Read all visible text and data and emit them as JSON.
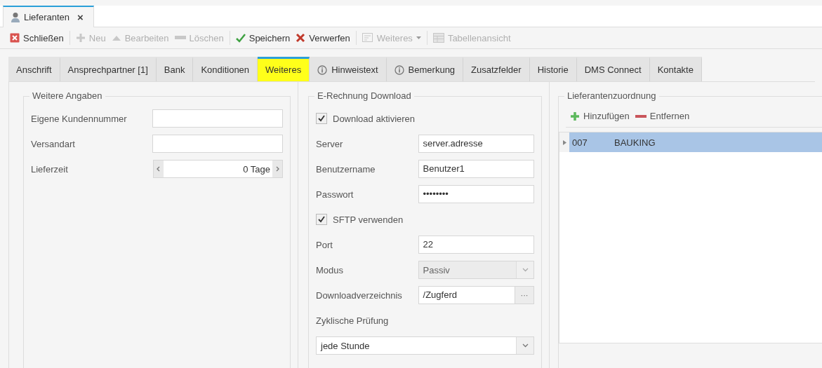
{
  "document_tab": {
    "title": "Lieferanten",
    "close": "×"
  },
  "toolbar": [
    {
      "kind": "close",
      "label": "Schließen",
      "disabled": false,
      "separator_after": true
    },
    {
      "kind": "new",
      "label": "Neu",
      "disabled": true,
      "separator_after": false
    },
    {
      "kind": "edit",
      "label": "Bearbeiten",
      "disabled": true,
      "separator_after": false
    },
    {
      "kind": "delete",
      "label": "Löschen",
      "disabled": true,
      "separator_after": true
    },
    {
      "kind": "save",
      "label": "Speichern",
      "disabled": false,
      "separator_after": false
    },
    {
      "kind": "discard",
      "label": "Verwerfen",
      "disabled": false,
      "separator_after": true
    },
    {
      "kind": "more",
      "label": "Weiteres",
      "disabled": true,
      "separator_after": true
    },
    {
      "kind": "table",
      "label": "Tabellenansicht",
      "disabled": true,
      "separator_after": false
    }
  ],
  "tabs": [
    {
      "label": "Anschrift",
      "kind": "plain",
      "selected": false
    },
    {
      "label": "Ansprechpartner [1]",
      "kind": "plain",
      "selected": false
    },
    {
      "label": "Bank",
      "kind": "plain",
      "selected": false
    },
    {
      "label": "Konditionen",
      "kind": "plain",
      "selected": false
    },
    {
      "label": "Weiteres",
      "kind": "plain",
      "selected": true
    },
    {
      "label": "Hinweistext",
      "kind": "info",
      "selected": false
    },
    {
      "label": "Bemerkung",
      "kind": "info",
      "selected": false
    },
    {
      "label": "Zusatzfelder",
      "kind": "plain",
      "selected": false
    },
    {
      "label": "Historie",
      "kind": "plain",
      "selected": false
    },
    {
      "label": "DMS Connect",
      "kind": "plain",
      "selected": false
    },
    {
      "label": "Kontakte",
      "kind": "plain",
      "selected": false
    }
  ],
  "weitere_angaben": {
    "title": "Weitere Angaben",
    "fields": [
      {
        "kind": "text",
        "label": "Eigene Kundennummer"
      },
      {
        "kind": "text",
        "label": "Versandart"
      },
      {
        "kind": "spinner",
        "label": "Lieferzeit",
        "value": "0 Tage"
      }
    ]
  },
  "e_rechnung": {
    "title": "E-Rechnung Download",
    "fields": [
      {
        "kind": "checkbox",
        "label": "Download aktivieren",
        "checked": true
      },
      {
        "kind": "text",
        "label": "Server",
        "value": "server.adresse"
      },
      {
        "kind": "text",
        "label": "Benutzername",
        "value": "Benutzer1"
      },
      {
        "kind": "text",
        "label": "Passwort",
        "value": "••••••••"
      },
      {
        "kind": "checkbox",
        "label": "SFTP verwenden",
        "checked": true
      },
      {
        "kind": "text",
        "label": "Port",
        "value": "22"
      },
      {
        "kind": "combo",
        "label": "Modus",
        "value": "Passiv",
        "disabled": true
      },
      {
        "kind": "browse",
        "label": "Downloadverzeichnis",
        "value": "/Zugferd",
        "button": "···"
      },
      {
        "kind": "stacked_combo",
        "label": "Zyklische Prüfung",
        "value": "jede Stunde",
        "disabled": false
      }
    ]
  },
  "lieferantenzuordnung": {
    "title": "Lieferantenzuordnung",
    "actions": [
      {
        "kind": "add",
        "label": "Hinzufügen"
      },
      {
        "kind": "remove",
        "label": "Entfernen"
      }
    ],
    "rows": [
      {
        "code": "007",
        "name": "BAUKING",
        "selected": true
      }
    ]
  }
}
